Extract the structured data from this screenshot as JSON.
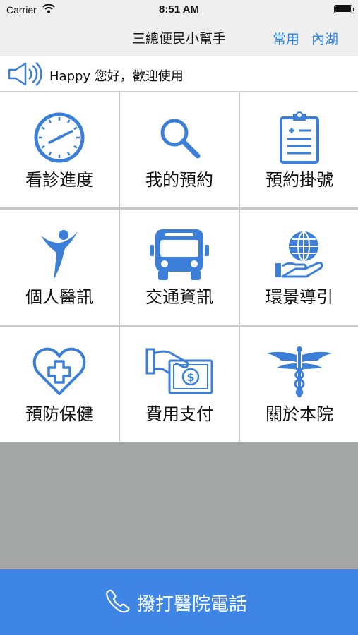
{
  "status_bar": {
    "carrier": "Carrier",
    "time": "8:51 AM"
  },
  "nav": {
    "title": "三總便民小幫手",
    "btn_common": "常用",
    "btn_neihu": "內湖"
  },
  "announcement": {
    "text": "Happy 您好，歡迎使用"
  },
  "menu": [
    {
      "label": "看診進度",
      "icon": "clock-icon"
    },
    {
      "label": "我的預約",
      "icon": "search-icon"
    },
    {
      "label": "預約掛號",
      "icon": "clipboard-icon"
    },
    {
      "label": "個人醫訊",
      "icon": "person-icon"
    },
    {
      "label": "交通資訊",
      "icon": "bus-icon"
    },
    {
      "label": "環景導引",
      "icon": "globe-hand-icon"
    },
    {
      "label": "預防保健",
      "icon": "heart-cross-icon"
    },
    {
      "label": "費用支付",
      "icon": "payment-icon"
    },
    {
      "label": "關於本院",
      "icon": "caduceus-icon"
    }
  ],
  "call_button": {
    "label": "撥打醫院電話"
  },
  "colors": {
    "accent": "#3f85e6",
    "icon_blue": "#3b7fd9",
    "nav_text": "#2a86ea",
    "background_gray": "#a3a6a4"
  }
}
